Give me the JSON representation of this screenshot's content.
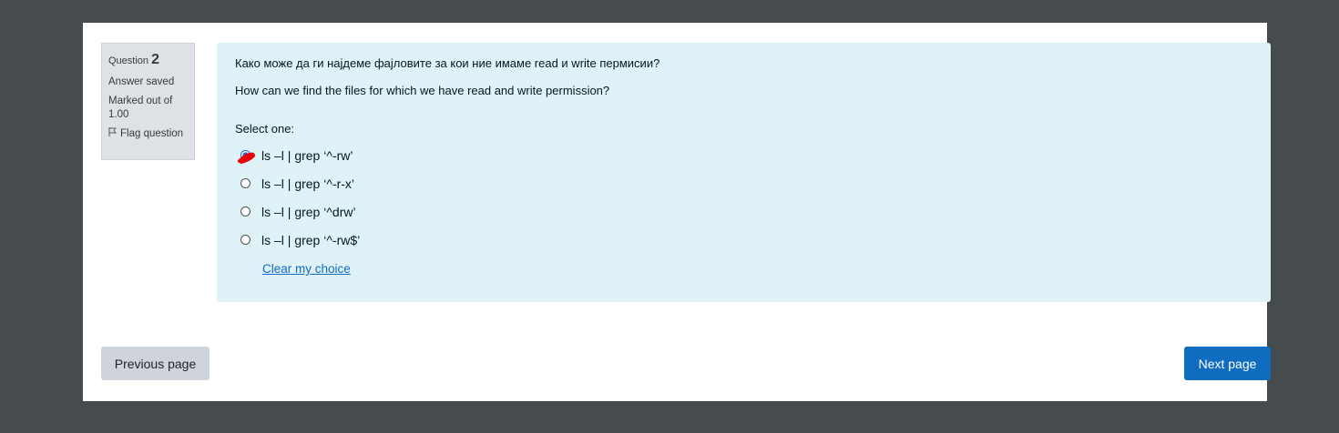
{
  "question_info": {
    "label": "Question",
    "number": "2",
    "state": "Answer saved",
    "grade": "Marked out of 1.00",
    "flag_label": "Flag question"
  },
  "question": {
    "text_mk": "Како може да ги најдеме фајловите за кои ние имаме read и write пермисии?",
    "text_en": "How can we find the files for which we have read and write permission?",
    "prompt": "Select one:",
    "options": [
      {
        "label": "ls –l | grep ‘^-rw’",
        "checked": true
      },
      {
        "label": "ls –l | grep ‘^-r-x’",
        "checked": false
      },
      {
        "label": "ls –l | grep ‘^drw’",
        "checked": false
      },
      {
        "label": "ls –l | grep ‘^-rw$’",
        "checked": false
      }
    ],
    "clear_label": "Clear my choice"
  },
  "navigation": {
    "previous_label": "Previous page",
    "next_label": "Next page"
  },
  "colors": {
    "background": "#464b4e",
    "info_box": "#dee2e6",
    "content_box": "#def2f8",
    "link": "#0f6cbf",
    "primary_button": "#0f6cbf",
    "secondary_button": "#ced4da",
    "scribble": "#e8000b"
  }
}
